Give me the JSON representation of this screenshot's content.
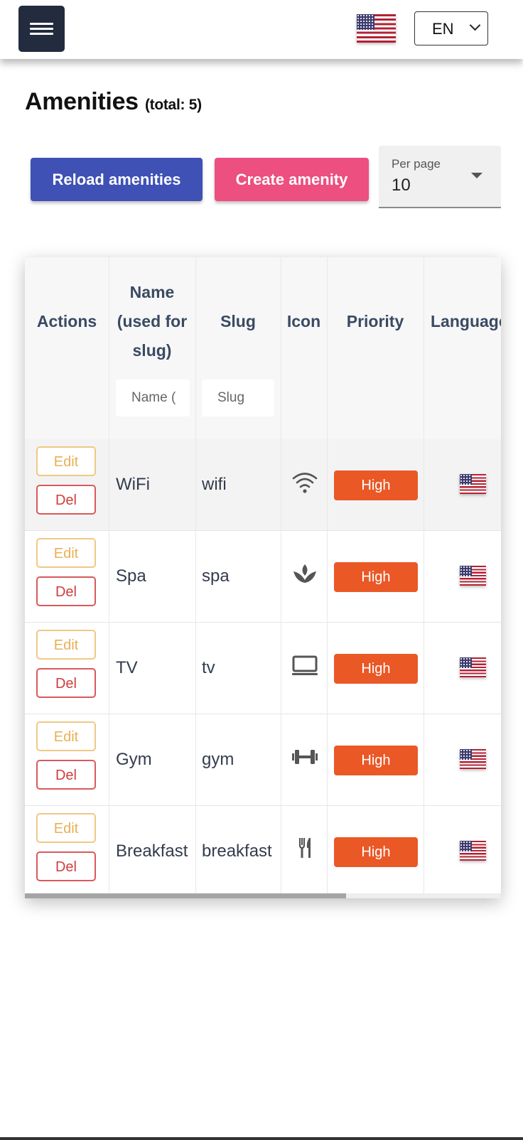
{
  "header": {
    "language_value": "EN",
    "flag_name": "us-flag"
  },
  "page": {
    "title": "Amenities",
    "total_text": "(total: 5)"
  },
  "toolbar": {
    "reload_label": "Reload amenities",
    "create_label": "Create amenity",
    "per_page_label": "Per page",
    "per_page_value": "10"
  },
  "table": {
    "headers": {
      "actions": "Actions",
      "name_line1": "Name",
      "name_line2": "(used for",
      "name_line3": "slug)",
      "slug": "Slug",
      "icon": "Icon",
      "priority": "Priority",
      "language": "Language"
    },
    "filters": {
      "name_placeholder": "Name (",
      "slug_placeholder": "Slug"
    },
    "edit_label": "Edit",
    "del_label": "Del",
    "rows": [
      {
        "name": "WiFi",
        "slug": "wifi",
        "icon": "wifi-icon",
        "priority": "High"
      },
      {
        "name": "Spa",
        "slug": "spa",
        "icon": "spa-icon",
        "priority": "High"
      },
      {
        "name": "TV",
        "slug": "tv",
        "icon": "tv-icon",
        "priority": "High"
      },
      {
        "name": "Gym",
        "slug": "gym",
        "icon": "dumbbell-icon",
        "priority": "High"
      },
      {
        "name": "Breakfast",
        "slug": "breakfast",
        "icon": "fork-knife-icon",
        "priority": "High"
      }
    ]
  },
  "colors": {
    "menu_bg": "#232b3e",
    "reload_bg": "#3f51b5",
    "create_bg": "#ec4f80",
    "priority_bg": "#ea5826",
    "edit_border": "#f0c884",
    "del_border": "#d9595a"
  }
}
